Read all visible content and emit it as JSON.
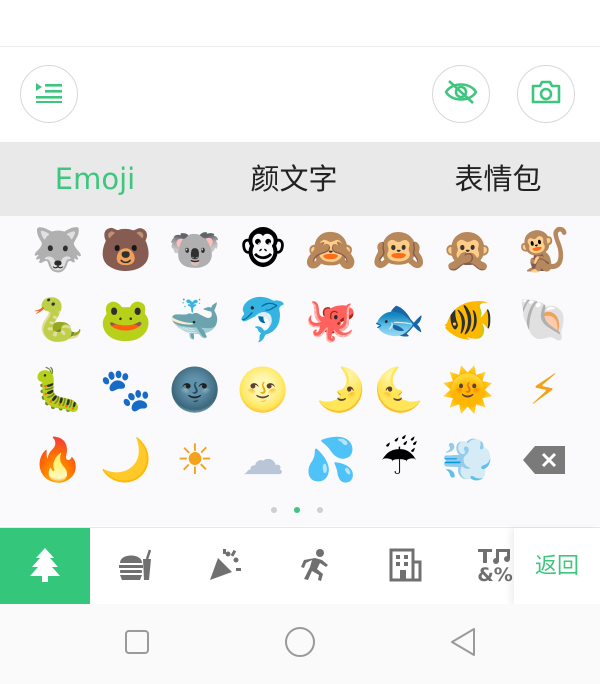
{
  "colors": {
    "accent": "#3ec67e",
    "tab_bg": "#e9e9e9",
    "cat_active_bg": "#34c77b"
  },
  "toolbar": {
    "menu_icon": "list-icon",
    "hide_icon": "eye-off-icon",
    "camera_icon": "camera-icon"
  },
  "tabs": [
    {
      "label": "Emoji",
      "active": true
    },
    {
      "label": "颜文字",
      "active": false
    },
    {
      "label": "表情包",
      "active": false
    }
  ],
  "emoji_rows": [
    [
      "🐺",
      "🐻",
      "🐨",
      "🐵",
      "🙈",
      "🙉",
      "🙊",
      "🐒"
    ],
    [
      "🐍",
      "🐸",
      "🐳",
      "🐬",
      "🐙",
      "🐟",
      "🐠",
      "🐚"
    ],
    [
      "🐛",
      "🐾",
      "🌚",
      "🌝",
      "🌛",
      "🌜",
      "🌞",
      "⚡"
    ],
    [
      "🔥",
      "🌙",
      "☀",
      "☁",
      "💦",
      "☔",
      "💨",
      "⌫"
    ]
  ],
  "pagination": {
    "pages": 3,
    "current": 2
  },
  "categories": [
    {
      "icon": "tree-icon",
      "active": true
    },
    {
      "icon": "food-icon",
      "active": false
    },
    {
      "icon": "party-icon",
      "active": false
    },
    {
      "icon": "running-icon",
      "active": false
    },
    {
      "icon": "building-icon",
      "active": false
    },
    {
      "icon": "symbols-icon",
      "active": false
    }
  ],
  "back_label": "返回",
  "symbols_glyph": "&%",
  "navbar": {
    "icons": [
      "square-icon",
      "circle-icon",
      "triangle-back-icon"
    ]
  }
}
